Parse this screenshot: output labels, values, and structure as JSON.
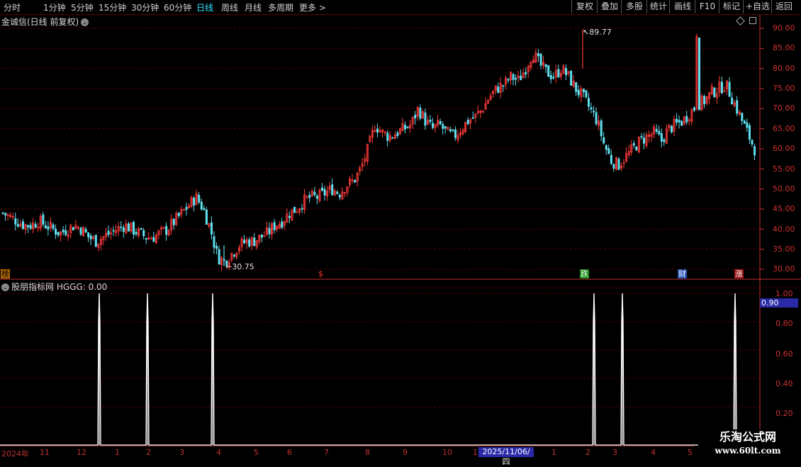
{
  "toolbar": {
    "periods": [
      "分时",
      "1分钟",
      "5分钟",
      "15分钟",
      "30分钟",
      "60分钟",
      "日线",
      "周线",
      "月线",
      "多周期",
      "更多 >"
    ],
    "active_period": "日线",
    "right_buttons": [
      "复权",
      "叠加",
      "多股",
      "统计",
      "画线",
      "F10",
      "标记",
      "+自选",
      "返回"
    ]
  },
  "main_chart": {
    "title": "金诚信(日线 前复权)",
    "y_labels": [
      "90.00",
      "85.00",
      "80.00",
      "75.00",
      "70.00",
      "65.00",
      "60.00",
      "55.00",
      "50.00",
      "45.00",
      "40.00",
      "35.00",
      "30.00"
    ],
    "max_annotation": "89.77",
    "min_annotation": "30.75",
    "event_markers": [
      "榜",
      "$",
      "跌",
      "财",
      "涨"
    ],
    "colors": {
      "up": "#ff3a3a",
      "down": "#5ee0f0",
      "grid": "#5a0000",
      "axis": "#c03030"
    }
  },
  "indicator": {
    "title": "股朋指标网 HGGG: 0.00",
    "y_labels": [
      "1.00",
      "0.80",
      "0.60",
      "0.40",
      "0.20"
    ],
    "current_value": "0.90"
  },
  "x_axis": {
    "labels": [
      "2024年",
      "11",
      "12",
      "1",
      "2",
      "3",
      "4",
      "5",
      "6",
      "7",
      "8",
      "9",
      "10",
      "1",
      "2",
      "3",
      "4",
      "5"
    ],
    "highlight_date": "2025/11/06/四",
    "after_highlight": [
      "1",
      "2",
      "3",
      "4",
      "5"
    ]
  },
  "watermark": {
    "line1": "乐淘公式网",
    "line2": "www.60lt.com"
  },
  "chart_data": {
    "type": "candlestick",
    "price_range": [
      28,
      93
    ],
    "max_price": 89.77,
    "min_price": 30.75,
    "close_path": [
      44,
      43,
      42,
      41,
      41,
      42,
      41,
      40,
      39,
      40,
      41,
      40,
      38,
      37,
      38,
      39,
      40,
      41,
      40,
      39,
      38,
      38,
      39,
      40,
      42,
      44,
      46,
      48,
      45,
      40,
      33,
      32,
      34,
      36,
      37,
      37,
      38,
      39,
      41,
      42,
      44,
      45,
      47,
      48,
      48,
      49,
      50,
      49,
      51,
      52,
      55,
      60,
      66,
      64,
      63,
      64,
      65,
      66,
      70,
      67,
      65,
      66,
      64,
      63,
      65,
      67,
      68,
      70,
      73,
      75,
      76,
      78,
      77,
      80,
      84,
      81,
      79,
      78,
      80,
      78,
      75,
      73,
      70,
      67,
      61,
      57,
      56,
      58,
      60,
      62,
      63,
      64,
      62,
      65,
      66,
      67,
      69,
      71,
      72,
      74,
      75,
      76,
      72,
      68,
      64,
      60
    ],
    "signals": {
      "type": "spike",
      "y_range": [
        0,
        1
      ],
      "positions_x": [
        140,
        208,
        300,
        838,
        878,
        1037
      ],
      "peak_value": 1.0
    }
  }
}
